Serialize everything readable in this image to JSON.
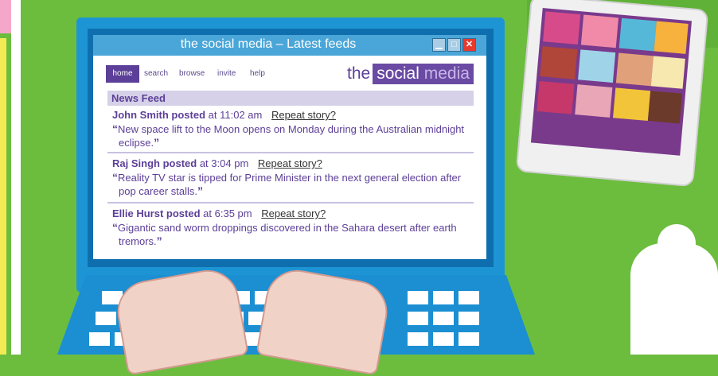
{
  "window": {
    "title": "the social media – Latest feeds",
    "minimize_glyph": "▁",
    "maximize_glyph": "□",
    "close_glyph": "✕"
  },
  "nav": {
    "items": [
      "home",
      "search",
      "browse",
      "invite",
      "help"
    ],
    "active": "home"
  },
  "logo": {
    "prefix": "the",
    "word1": "social",
    "word2": "media"
  },
  "feed": {
    "header": "News Feed",
    "posted_label": "posted",
    "at_label": "at",
    "repeat_label": "Repeat story?",
    "posts": [
      {
        "name": "John Smith",
        "time": "11:02 am",
        "text": "New space lift to the Moon opens on Monday during the Australian midnight eclipse."
      },
      {
        "name": "Raj Singh",
        "time": "3:04 pm",
        "text": "Reality TV star is tipped for Prime Minister in the next general election after pop career stalls."
      },
      {
        "name": "Ellie Hurst",
        "time": "6:35 pm",
        "text": "Gigantic sand worm droppings discovered in the Sahara desert after earth tremors."
      }
    ]
  },
  "colors": {
    "background_green": "#6cbd3e",
    "laptop_blue": "#1d95d4",
    "accent_purple": "#5c3f98"
  }
}
